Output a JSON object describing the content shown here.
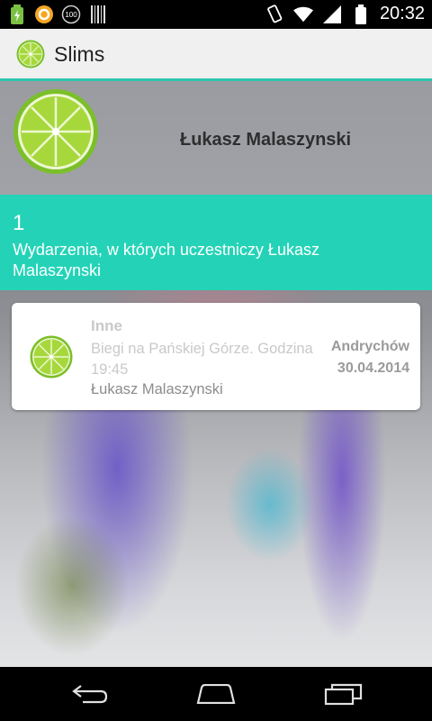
{
  "status_bar": {
    "time": "20:32",
    "left_icons": [
      "battery-charging-icon",
      "orange-circle-app-icon",
      "100-badge-icon",
      "barcode-icon"
    ],
    "right_icons": [
      "vibrate-icon",
      "wifi-icon",
      "signal-icon",
      "battery-icon"
    ]
  },
  "action_bar": {
    "title": "Slims",
    "logo_icon": "lime-icon"
  },
  "header": {
    "name": "Łukasz Malaszynski"
  },
  "summary": {
    "count": "1",
    "text": "Wydarzenia, w których uczestniczy Łukasz Malaszynski"
  },
  "events": [
    {
      "category": "Inne",
      "description": "Biegi na Pańskiej Górze. Godzina 19:45",
      "person": "Łukasz Malaszynski",
      "city": "Andrychów",
      "date": "30.04.2014"
    }
  ],
  "nav": {
    "icons": [
      "back-icon",
      "home-icon",
      "recent-apps-icon"
    ]
  },
  "colors": {
    "accent": "#24d3b7",
    "actionbar_line": "#2cc6ad"
  }
}
